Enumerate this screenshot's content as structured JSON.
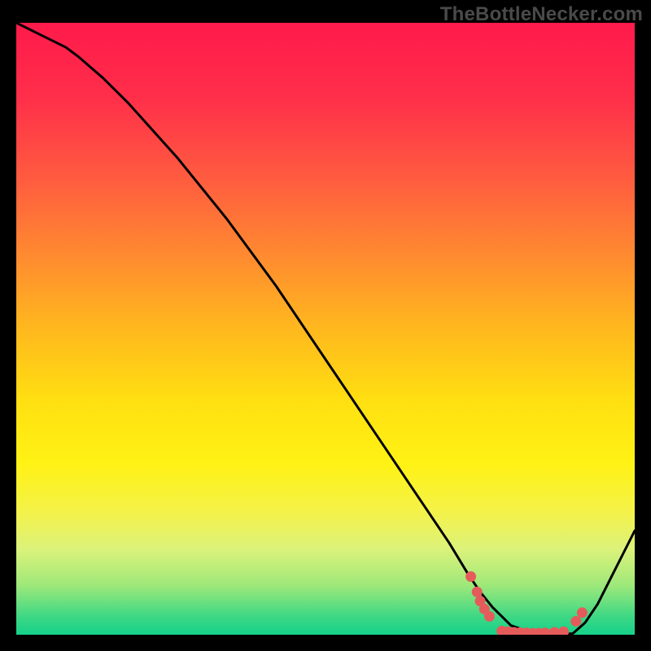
{
  "watermark": "TheBottleNecker.com",
  "colors": {
    "bg": "#000000",
    "curve": "#000000",
    "marker_fill": "#E55B5B",
    "marker_stroke": "#E55B5B",
    "gradient_stops": [
      {
        "offset": 0.0,
        "color": "#FF1A4B"
      },
      {
        "offset": 0.12,
        "color": "#FF2E4A"
      },
      {
        "offset": 0.25,
        "color": "#FF5A40"
      },
      {
        "offset": 0.38,
        "color": "#FF8A30"
      },
      {
        "offset": 0.5,
        "color": "#FFB81E"
      },
      {
        "offset": 0.62,
        "color": "#FFE011"
      },
      {
        "offset": 0.72,
        "color": "#FFF214"
      },
      {
        "offset": 0.8,
        "color": "#F4F24A"
      },
      {
        "offset": 0.86,
        "color": "#DCF27A"
      },
      {
        "offset": 0.92,
        "color": "#9DE87A"
      },
      {
        "offset": 0.97,
        "color": "#3ED884"
      },
      {
        "offset": 1.0,
        "color": "#15D18A"
      }
    ]
  },
  "chart_data": {
    "type": "line",
    "title": "",
    "xlabel": "",
    "ylabel": "",
    "xlim": [
      0,
      100
    ],
    "ylim": [
      0,
      100
    ],
    "x": [
      0,
      2,
      4,
      6,
      8,
      10,
      14,
      18,
      22,
      26,
      30,
      34,
      38,
      42,
      46,
      50,
      54,
      58,
      62,
      66,
      70,
      73,
      75,
      77,
      79,
      80,
      82,
      84,
      86,
      88,
      90,
      92,
      94,
      96,
      98,
      100
    ],
    "values": [
      100,
      99,
      98,
      97,
      96,
      94.5,
      91,
      87,
      82.5,
      78,
      73,
      68,
      62.5,
      57,
      51,
      45,
      39,
      33,
      27,
      21,
      15,
      10,
      7,
      4.5,
      2.5,
      1.5,
      0.8,
      0.3,
      0.1,
      0.05,
      0.2,
      2,
      5,
      9,
      13,
      17
    ],
    "plateau_x_range": [
      74,
      90
    ],
    "markers": [
      {
        "x": 73.5,
        "y": 9.5
      },
      {
        "x": 74.5,
        "y": 7.0
      },
      {
        "x": 75.0,
        "y": 5.5
      },
      {
        "x": 75.7,
        "y": 4.2
      },
      {
        "x": 76.5,
        "y": 3.0
      },
      {
        "x": 78.5,
        "y": 0.6
      },
      {
        "x": 79.5,
        "y": 0.5
      },
      {
        "x": 80.5,
        "y": 0.4
      },
      {
        "x": 81.5,
        "y": 0.35
      },
      {
        "x": 82.5,
        "y": 0.3
      },
      {
        "x": 83.5,
        "y": 0.25
      },
      {
        "x": 84.5,
        "y": 0.25
      },
      {
        "x": 85.5,
        "y": 0.3
      },
      {
        "x": 87.0,
        "y": 0.4
      },
      {
        "x": 88.5,
        "y": 0.5
      },
      {
        "x": 90.5,
        "y": 2.2
      },
      {
        "x": 91.5,
        "y": 3.6
      }
    ]
  }
}
